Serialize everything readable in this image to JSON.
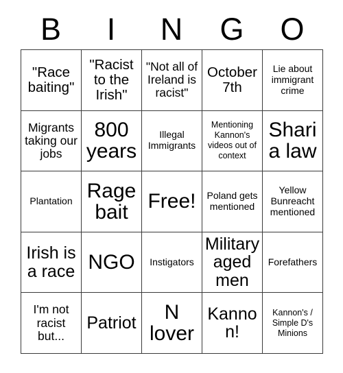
{
  "card": {
    "title": "BINGO Card",
    "header_letters": [
      "B",
      "I",
      "N",
      "G",
      "O"
    ],
    "columns": 5,
    "rows": 5,
    "border_color": "#3a3a3a",
    "text_color": "#000000",
    "background_color": "#ffffff",
    "cells": [
      [
        {
          "text": "\"Race baiting\"",
          "size": "lg"
        },
        {
          "text": "\"Racist to the Irish\"",
          "size": "lg"
        },
        {
          "text": "\"Not all of Ireland is racist\"",
          "size": "md"
        },
        {
          "text": "October 7th",
          "size": "lg"
        },
        {
          "text": "Lie about immigrant crime",
          "size": "sm"
        }
      ],
      [
        {
          "text": "Migrants taking our jobs",
          "size": "md"
        },
        {
          "text": "800 years",
          "size": "xxl"
        },
        {
          "text": "Illegal Immigrants",
          "size": "sm"
        },
        {
          "text": "Mentioning Kannon's videos out of context",
          "size": "xs"
        },
        {
          "text": "Sharia law",
          "size": "xxl"
        }
      ],
      [
        {
          "text": "Plantation",
          "size": "sm"
        },
        {
          "text": "Rage bait",
          "size": "xxl"
        },
        {
          "text": "Free!",
          "size": "xxl"
        },
        {
          "text": "Poland gets mentioned",
          "size": "sm"
        },
        {
          "text": "Yellow Bunreacht mentioned",
          "size": "sm"
        }
      ],
      [
        {
          "text": "Irish is a race",
          "size": "xl"
        },
        {
          "text": "NGO",
          "size": "xxl"
        },
        {
          "text": "Instigators",
          "size": "sm"
        },
        {
          "text": "Military aged men",
          "size": "xl"
        },
        {
          "text": "Forefathers",
          "size": "sm"
        }
      ],
      [
        {
          "text": "I'm not racist but...",
          "size": "md"
        },
        {
          "text": "Patriot",
          "size": "xl"
        },
        {
          "text": "N lover",
          "size": "xxl"
        },
        {
          "text": "Kannon!",
          "size": "xl"
        },
        {
          "text": "Kannon's / Simple D's Minions",
          "size": "xs"
        }
      ]
    ]
  }
}
